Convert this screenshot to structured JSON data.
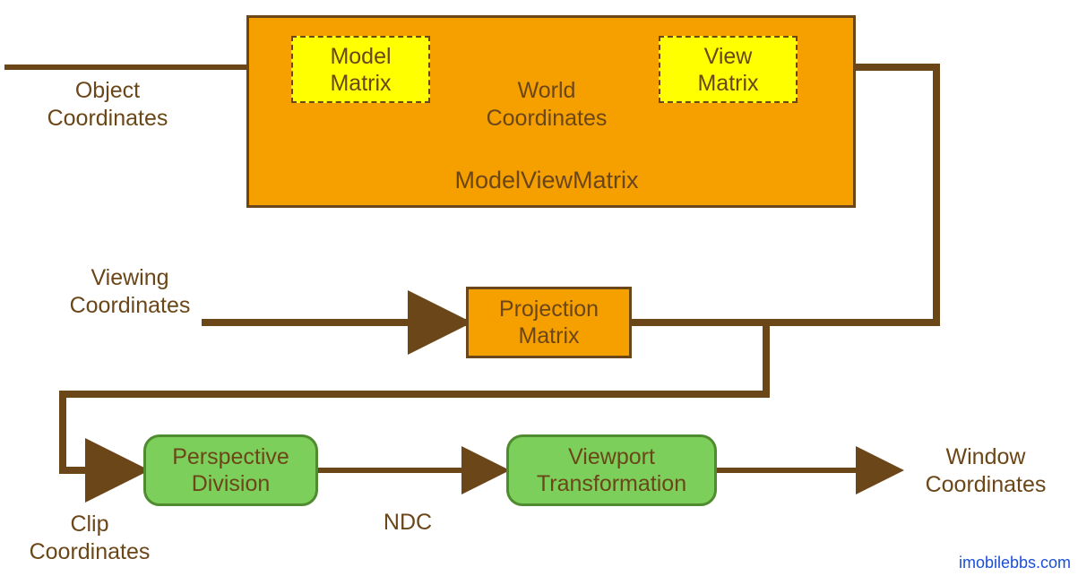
{
  "boxes": {
    "model_matrix": "Model\nMatrix",
    "view_matrix": "View\nMatrix",
    "modelview_label": "ModelViewMatrix",
    "projection_matrix": "Projection\nMatrix",
    "perspective_division": "Perspective\nDivision",
    "viewport_transformation": "Viewport\nTransformation"
  },
  "labels": {
    "object_coordinates": "Object\nCoordinates",
    "world_coordinates": "World\nCoordinates",
    "viewing_coordinates": "Viewing\nCoordinates",
    "clip_coordinates": "Clip\nCoordinates",
    "ndc": "NDC",
    "window_coordinates": "Window\nCoordinates"
  },
  "watermark": "imobilebbs.com",
  "colors": {
    "line": "#6b4618",
    "orange": "#f6a000",
    "yellow": "#ffff00",
    "green_fill": "#7dcf5c",
    "green_border": "#4f8b2f"
  }
}
